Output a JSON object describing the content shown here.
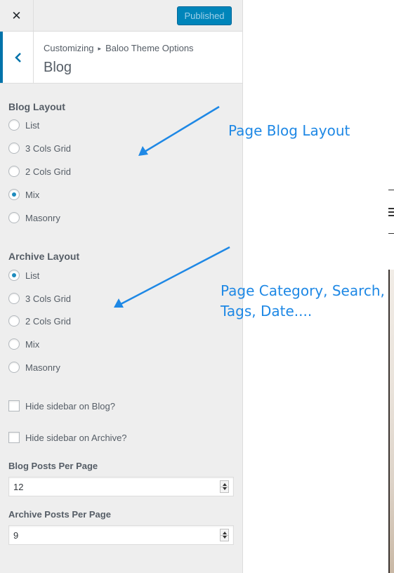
{
  "topbar": {
    "close_glyph": "✕",
    "publish_label": "Published"
  },
  "header": {
    "breadcrumb_root": "Customizing",
    "breadcrumb_separator": "▸",
    "breadcrumb_parent": "Baloo Theme Options",
    "title": "Blog"
  },
  "blog_layout": {
    "title": "Blog Layout",
    "options": [
      "List",
      "3 Cols Grid",
      "2 Cols Grid",
      "Mix",
      "Masonry"
    ],
    "selected": "Mix"
  },
  "archive_layout": {
    "title": "Archive Layout",
    "options": [
      "List",
      "3 Cols Grid",
      "2 Cols Grid",
      "Mix",
      "Masonry"
    ],
    "selected": "List"
  },
  "checkboxes": {
    "hide_blog": {
      "label": "Hide sidebar on Blog?",
      "checked": false
    },
    "hide_archive": {
      "label": "Hide sidebar on Archive?",
      "checked": false
    }
  },
  "blog_posts_per_page": {
    "label": "Blog Posts Per Page",
    "value": "12"
  },
  "archive_posts_per_page": {
    "label": "Archive Posts Per Page",
    "value": "9"
  },
  "annotations": {
    "blog": "Page Blog Layout",
    "archive_line1": "Page Category, Search,",
    "archive_line2": "Tags, Date....",
    "color": "#1e88e5"
  },
  "colors": {
    "accent": "#0085ba",
    "radio_dot": "#1e8cbe",
    "panel_bg": "#eeeeee"
  }
}
